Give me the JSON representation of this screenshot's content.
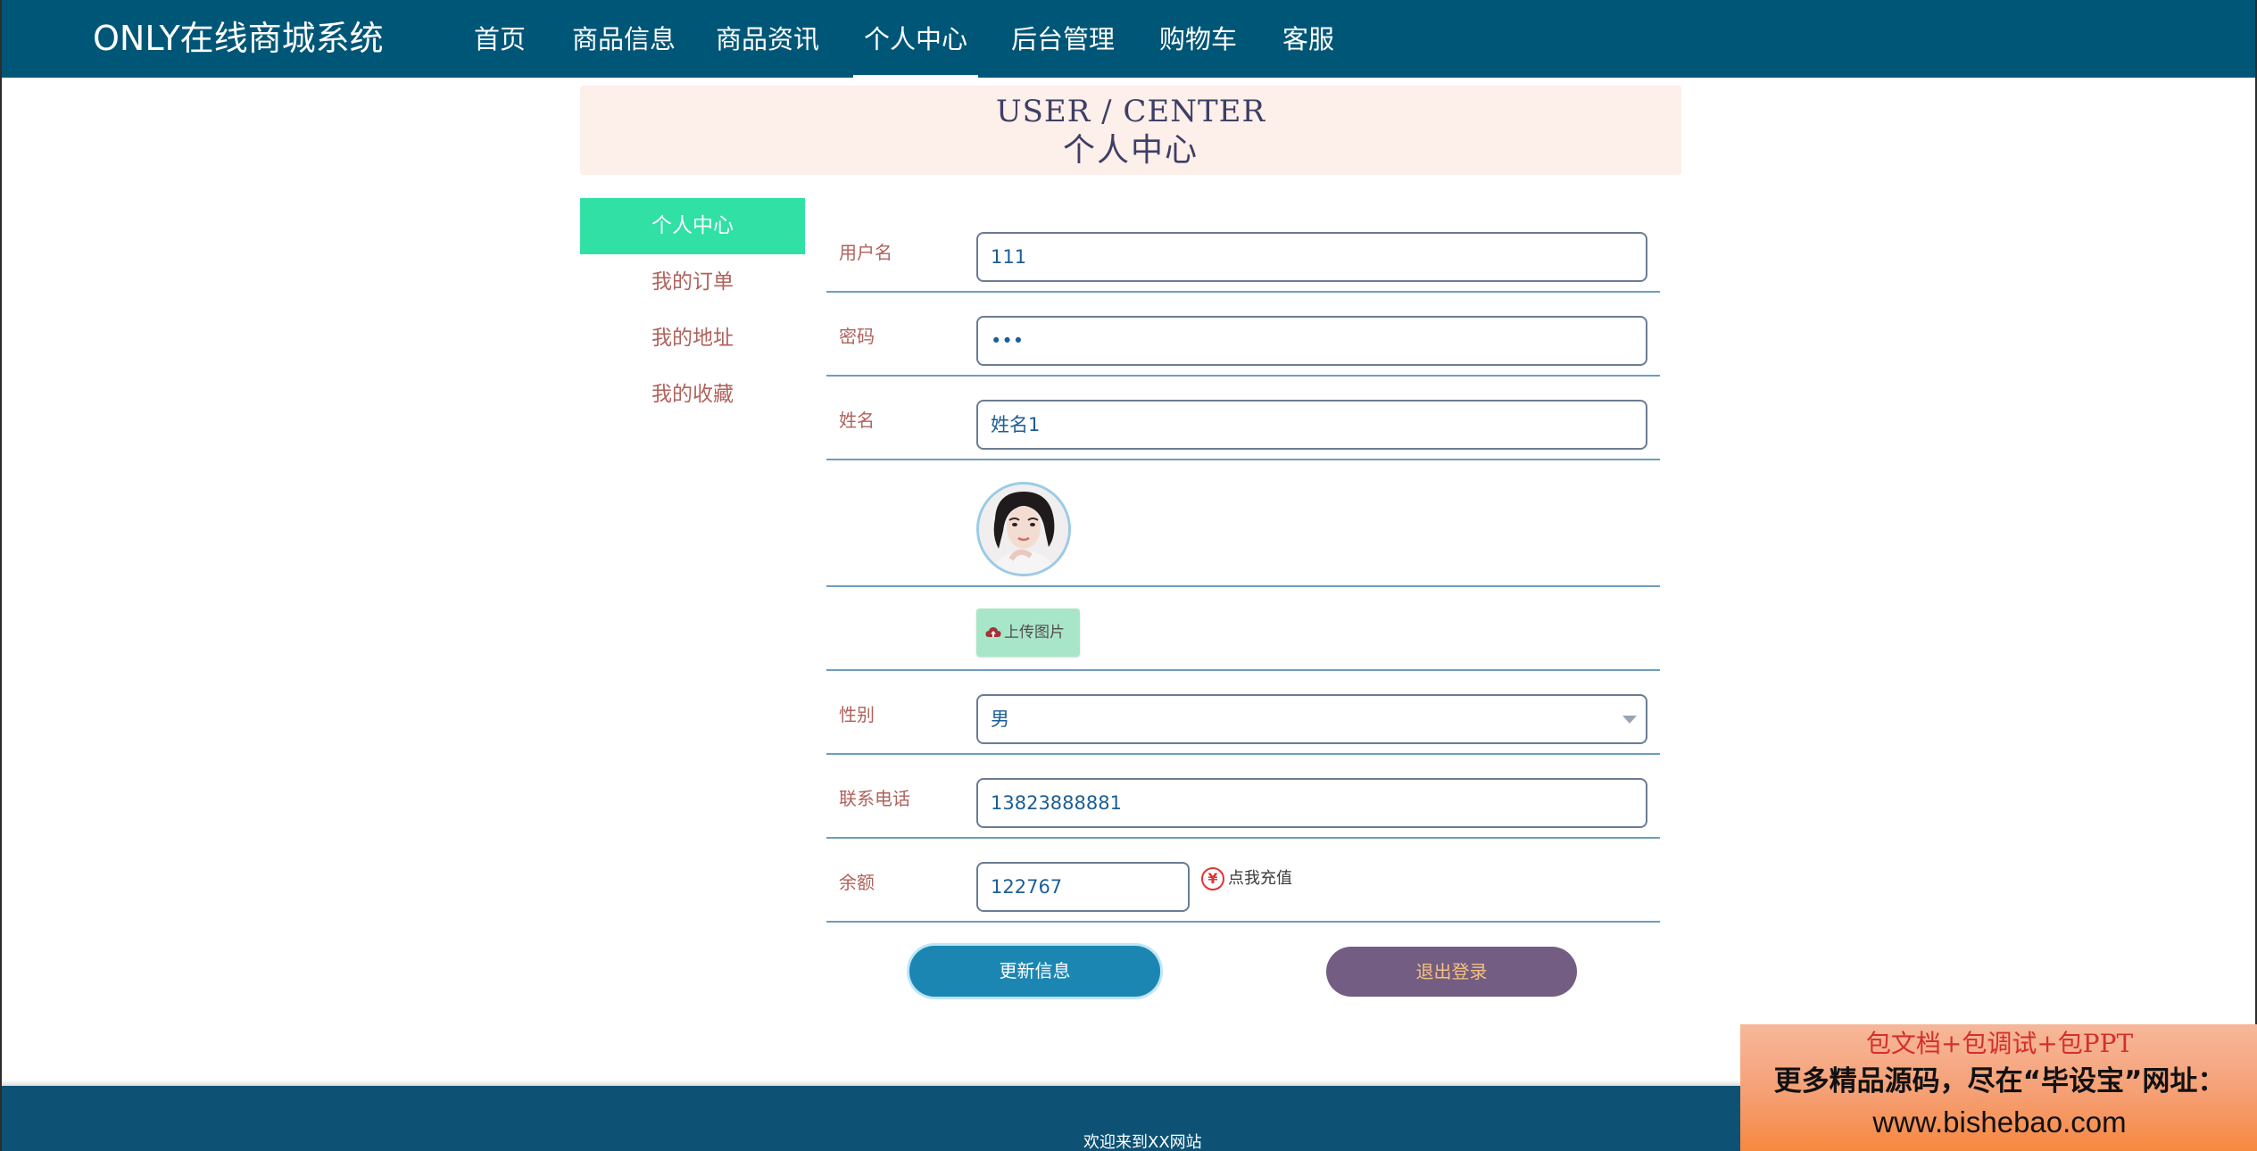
{
  "app": {
    "brand": "ONLY在线商城系统"
  },
  "nav": {
    "items": [
      {
        "label": "首页"
      },
      {
        "label": "商品信息"
      },
      {
        "label": "商品资讯"
      },
      {
        "label": "个人中心",
        "active": true
      },
      {
        "label": "后台管理"
      },
      {
        "label": "购物车"
      },
      {
        "label": "客服"
      }
    ]
  },
  "banner": {
    "title_en": "USER / CENTER",
    "title_cn": "个人中心"
  },
  "side_menu": {
    "items": [
      {
        "label": "个人中心",
        "active": true
      },
      {
        "label": "我的订单"
      },
      {
        "label": "我的地址"
      },
      {
        "label": "我的收藏"
      }
    ]
  },
  "form": {
    "username": {
      "label": "用户名",
      "value": "111"
    },
    "password": {
      "label": "密码",
      "value": "•••"
    },
    "name": {
      "label": "姓名",
      "value": "姓名1"
    },
    "avatar": {
      "icon": "avatar-portrait"
    },
    "upload": {
      "label": "上传图片",
      "icon": "cloud-upload-icon"
    },
    "gender": {
      "label": "性别",
      "value": "男"
    },
    "phone": {
      "label": "联系电话",
      "value": "13823888881"
    },
    "balance": {
      "label": "余额",
      "value": "122767",
      "recharge_icon": "¥",
      "recharge_label": "点我充值"
    }
  },
  "actions": {
    "update_label": "更新信息",
    "logout_label": "退出登录"
  },
  "footer": {
    "text": "欢迎来到XX网站"
  },
  "ad": {
    "line1": "包文档+包调试+包PPT",
    "line2": "更多精品源码，尽在“毕设宝”网址：",
    "line3": "www.bishebao.com"
  },
  "colors": {
    "topbar": "#005677",
    "accent_green": "#30e0a4",
    "label_text": "#b0625c",
    "update_button": "#1c86b2",
    "logout_button": "#735d82",
    "footer": "#0d5275"
  }
}
